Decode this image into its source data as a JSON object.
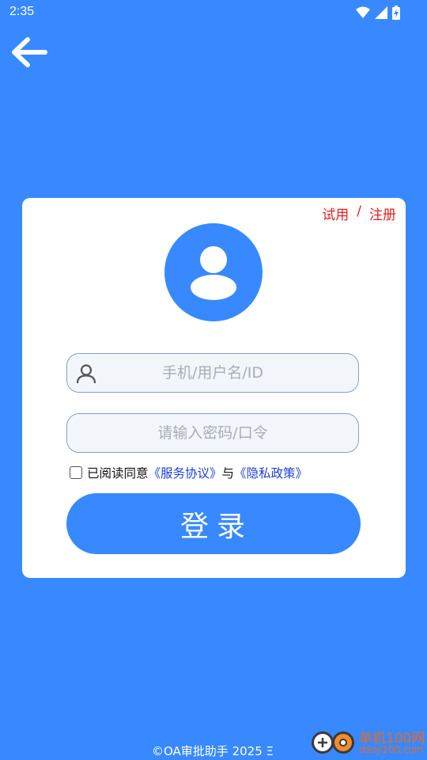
{
  "status_bar": {
    "time": "2:35",
    "icons": [
      "wifi-icon",
      "signal-icon",
      "battery-charging-icon"
    ]
  },
  "header": {
    "back_icon": "arrow-left-icon"
  },
  "card": {
    "trial_label": "试用",
    "separator": "/",
    "register_label": "注册",
    "avatar_icon": "user-avatar-icon",
    "username": {
      "value": "",
      "placeholder": "手机/用户名/ID",
      "icon": "user-outline-icon"
    },
    "password": {
      "value": "",
      "placeholder": "请输入密码/口令"
    },
    "agreement": {
      "checked": false,
      "prefix": "已阅读同意",
      "service_link": "《服务协议》",
      "conjunction": "与",
      "privacy_link": "《隐私政策》"
    },
    "login_label": "登录"
  },
  "footer": {
    "text": "©OA审批助手 2025 Ξ"
  },
  "watermark": {
    "title": "单机100网",
    "url": "danji100.com"
  },
  "colors": {
    "background": "#3889FF",
    "card": "#FFFFFF",
    "accent_red": "#E02020",
    "link_blue": "#1A3FD6",
    "button": "#3889FF"
  }
}
